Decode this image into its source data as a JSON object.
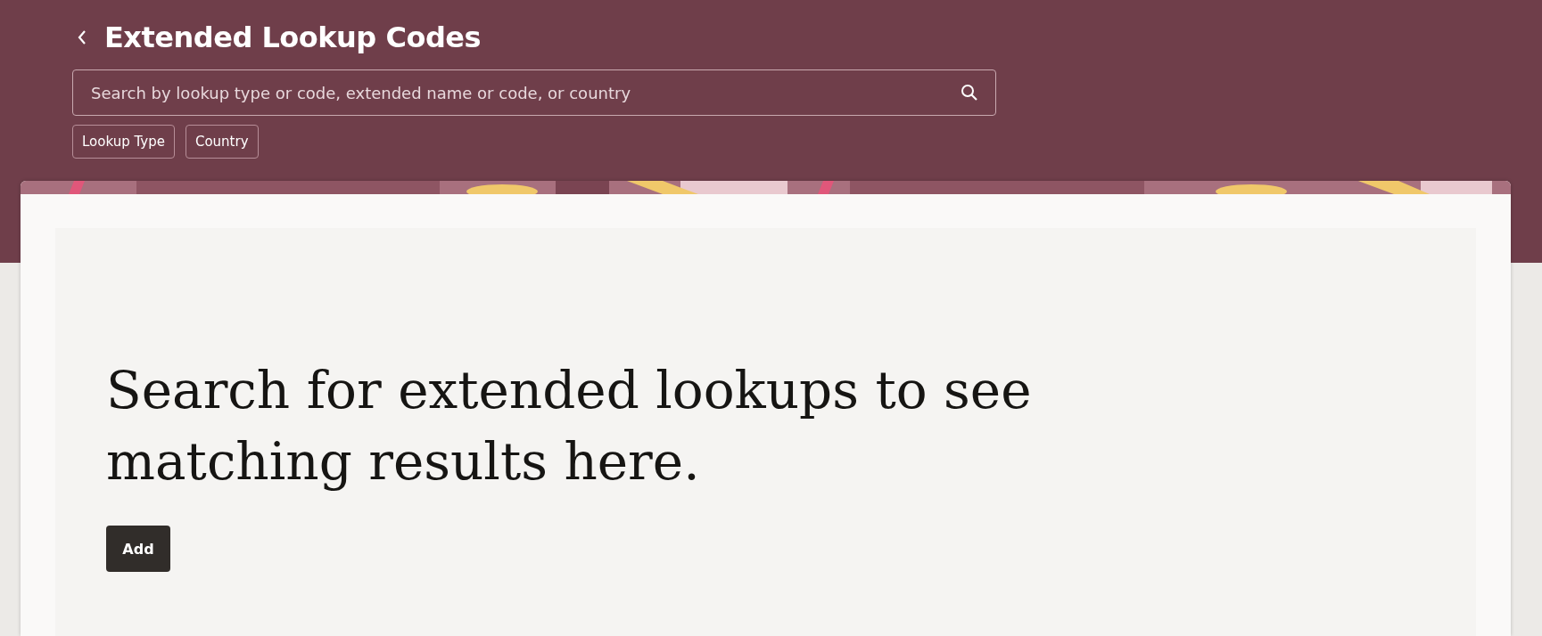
{
  "header": {
    "title": "Extended Lookup Codes"
  },
  "search": {
    "placeholder": "Search by lookup type or code, extended name or code, or country"
  },
  "filters": [
    {
      "label": "Lookup Type"
    },
    {
      "label": "Country"
    }
  ],
  "empty_state": {
    "message": "Search for extended lookups to see matching results here.",
    "button": "Add"
  }
}
